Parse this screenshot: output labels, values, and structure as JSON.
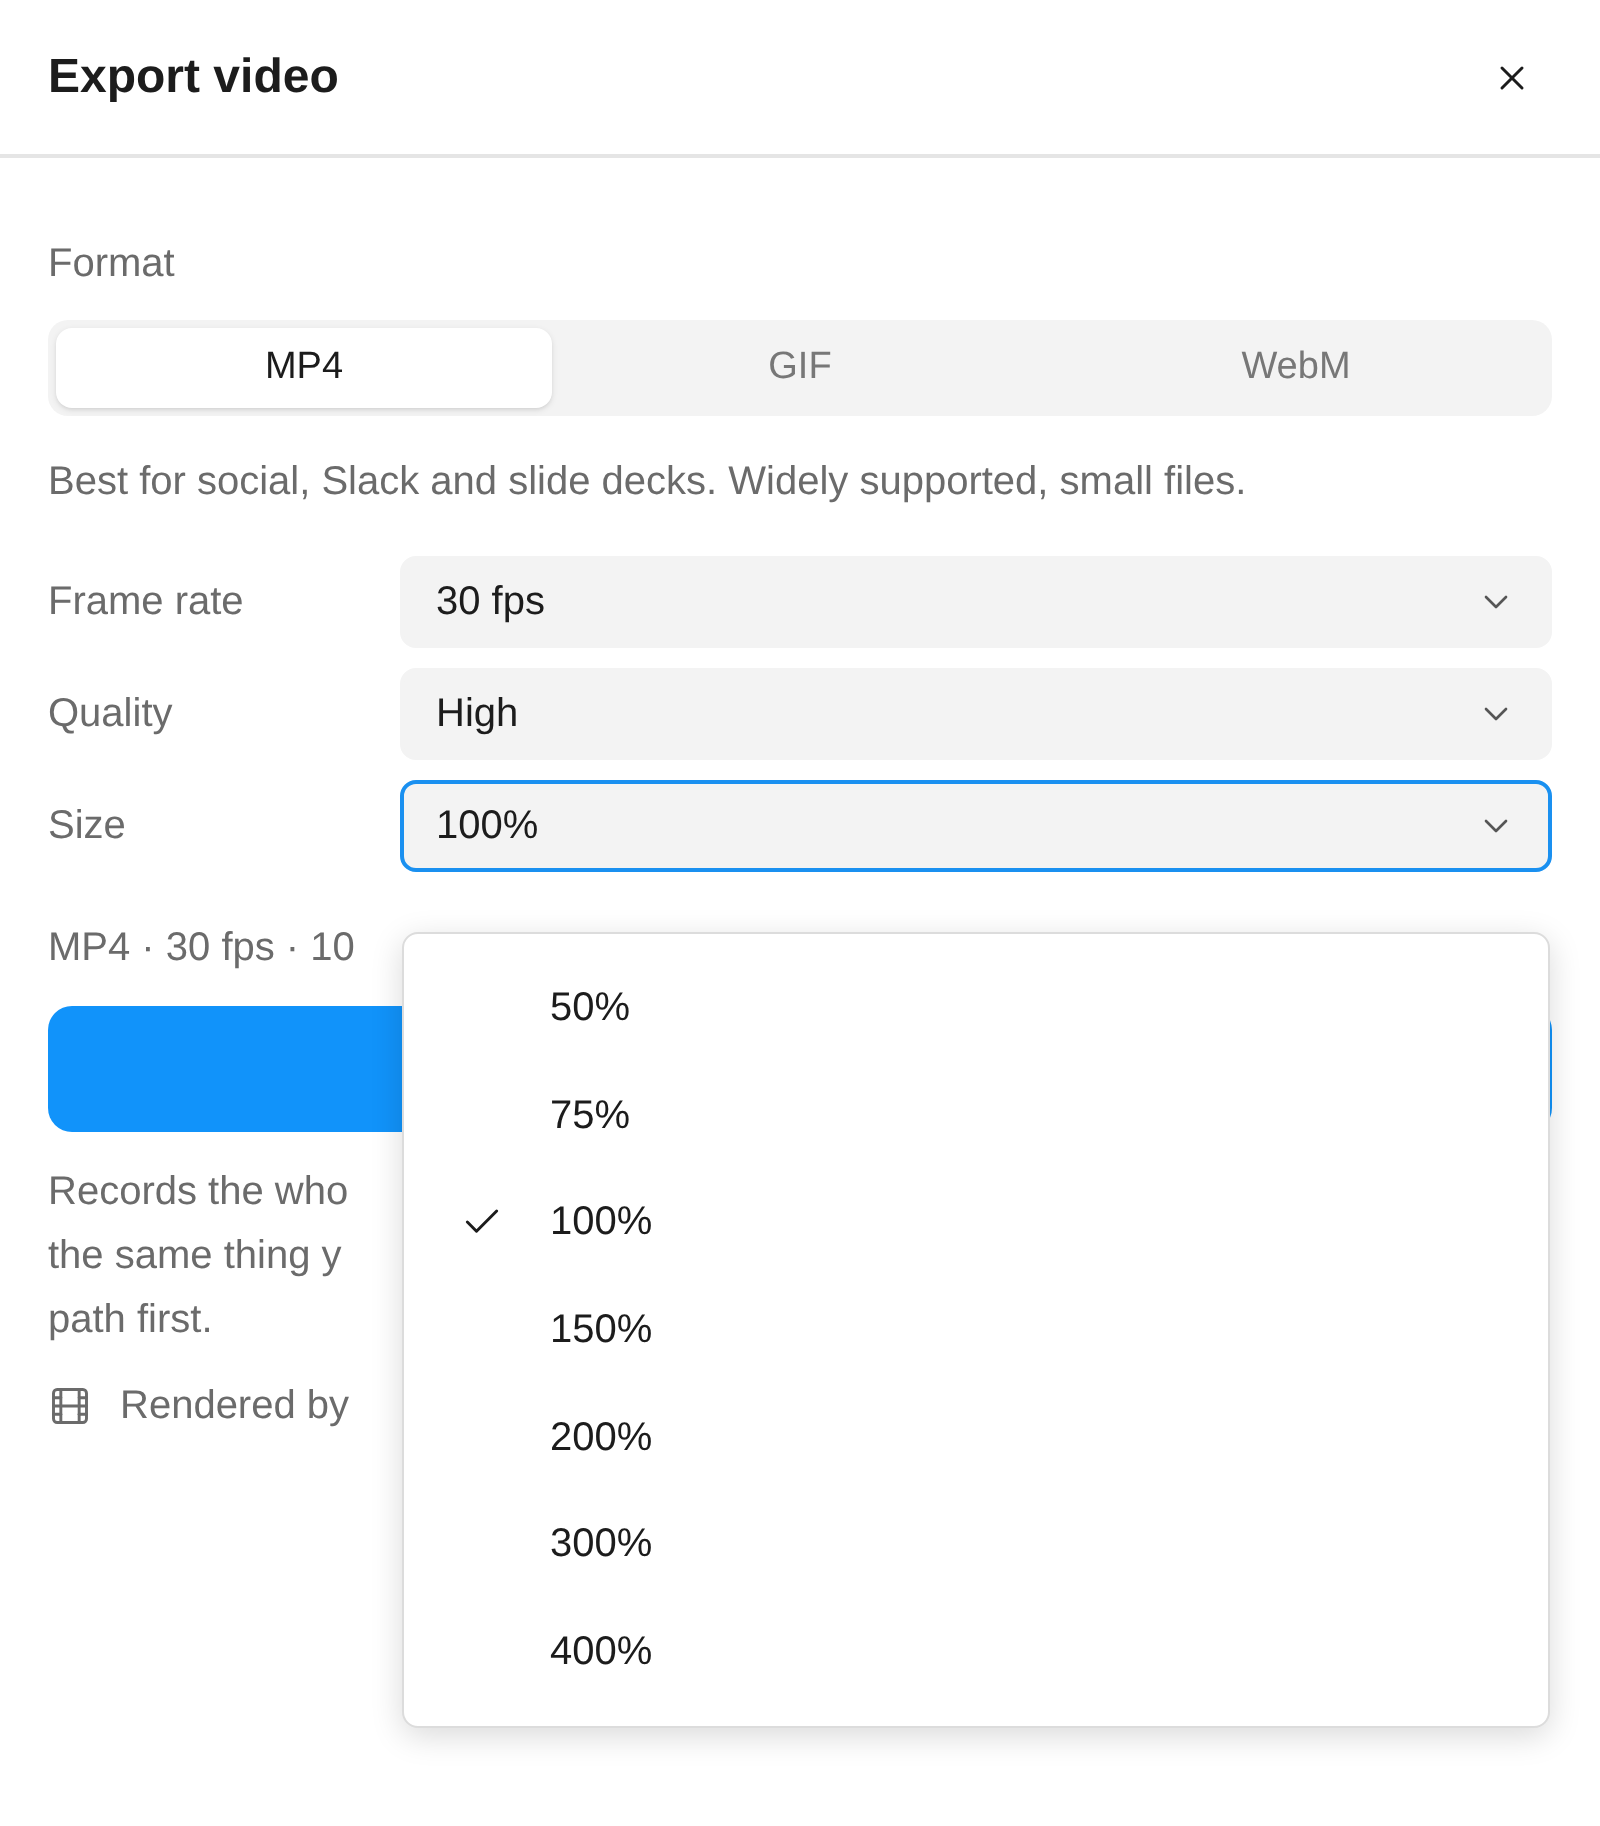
{
  "window": {
    "title": "Export video"
  },
  "format": {
    "label": "Format",
    "tabs": [
      {
        "label": "MP4",
        "selected": true
      },
      {
        "label": "GIF",
        "selected": false
      },
      {
        "label": "WebM",
        "selected": false
      }
    ],
    "description": "Best for social, Slack and slide decks. Widely supported, small files."
  },
  "settings": [
    {
      "label": "Frame rate",
      "value": "30 fps",
      "focused": false
    },
    {
      "label": "Quality",
      "value": "High",
      "focused": false
    },
    {
      "label": "Size",
      "value": "100%",
      "focused": true
    }
  ],
  "summary": "MP4 · 30 fps · 10",
  "note_lines": [
    "Records the who",
    "the same thing y",
    "path first."
  ],
  "footer": "Rendered by",
  "dropdown": {
    "options": [
      {
        "label": "50%",
        "selected": false
      },
      {
        "label": "75%",
        "selected": false
      },
      {
        "label": "100%",
        "selected": true
      },
      {
        "label": "150%",
        "selected": false
      },
      {
        "label": "200%",
        "selected": false
      },
      {
        "label": "300%",
        "selected": false
      },
      {
        "label": "400%",
        "selected": false
      }
    ]
  }
}
